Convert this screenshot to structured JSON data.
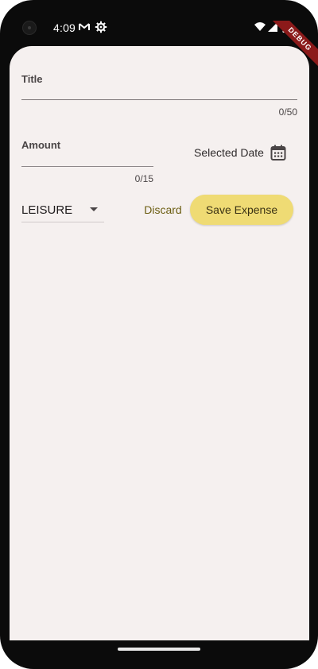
{
  "status_bar": {
    "time": "4:09",
    "left_icons": [
      "gmail-icon",
      "settings-icon"
    ],
    "right_icons": [
      "wifi-icon",
      "signal-icon",
      "battery-icon"
    ],
    "debug_banner": "DEBUG"
  },
  "form": {
    "title_label": "Title",
    "title_value": "",
    "title_counter": "0/50",
    "amount_label": "Amount",
    "amount_value": "",
    "amount_counter": "0/15",
    "selected_date": "Selected Date",
    "calendar_icon": "calendar-icon",
    "category": {
      "selected": "LEISURE"
    },
    "discard_label": "Discard",
    "save_label": "Save Expense"
  },
  "colors": {
    "screen_background": "#f5f0ef",
    "save_button": "#efdb74",
    "discard_text": "#6b5d11",
    "debug_ribbon": "#8b1a1a"
  }
}
